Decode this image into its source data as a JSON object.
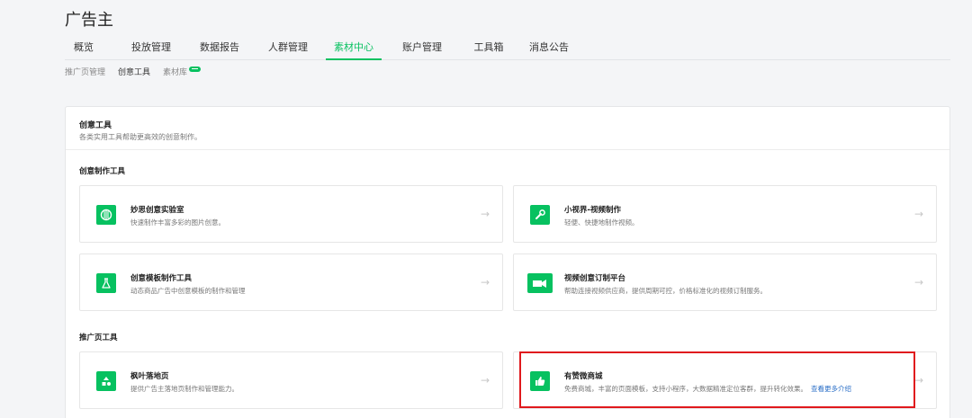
{
  "header": {
    "title": "广告主"
  },
  "nav": {
    "tabs": [
      {
        "label": "概览"
      },
      {
        "label": "投放管理"
      },
      {
        "label": "数据报告"
      },
      {
        "label": "人群管理"
      },
      {
        "label": "素材中心"
      },
      {
        "label": "账户管理"
      },
      {
        "label": "工具箱"
      },
      {
        "label": "消息公告"
      }
    ],
    "active": "素材中心"
  },
  "subnav": {
    "tabs": [
      {
        "label": "推广页管理"
      },
      {
        "label": "创意工具"
      },
      {
        "label": "素材库"
      }
    ],
    "active": "创意工具"
  },
  "panel": {
    "title": "创意工具",
    "desc": "各类实用工具帮助更高效的创意制作。",
    "sections": [
      {
        "title": "创意制作工具",
        "cards": [
          {
            "name": "妙思创意实验室",
            "desc": "快速制作丰富多彩的图片创意。",
            "icon": "aperture-icon"
          },
          {
            "name": "小视界-视频制作",
            "desc": "轻便、快捷地制作视频。",
            "icon": "wrench-icon"
          },
          {
            "name": "创意模板制作工具",
            "desc": "动态商品广告中创意模板的制作和管理",
            "icon": "flask-icon"
          },
          {
            "name": "视频创意订制平台",
            "desc": "帮助连接视频供应商，提供周期可控，价格标准化的视频订制服务。",
            "icon": "camera-handshake-icon"
          }
        ]
      },
      {
        "title": "推广页工具",
        "cards": [
          {
            "name": "枫叶落地页",
            "desc": "提供广告主落地页制作和管理能力。",
            "icon": "shapes-icon"
          },
          {
            "name": "有赞微商城",
            "desc": "免费商城，丰富的页面模板，支持小程序，大数据精准定位客群，提升转化效果。",
            "link": "查看更多介绍",
            "icon": "thumbs-up-icon"
          }
        ]
      }
    ]
  },
  "colors": {
    "accent": "#07c160",
    "highlight": "#e0191d",
    "link": "#2b6fc7"
  }
}
